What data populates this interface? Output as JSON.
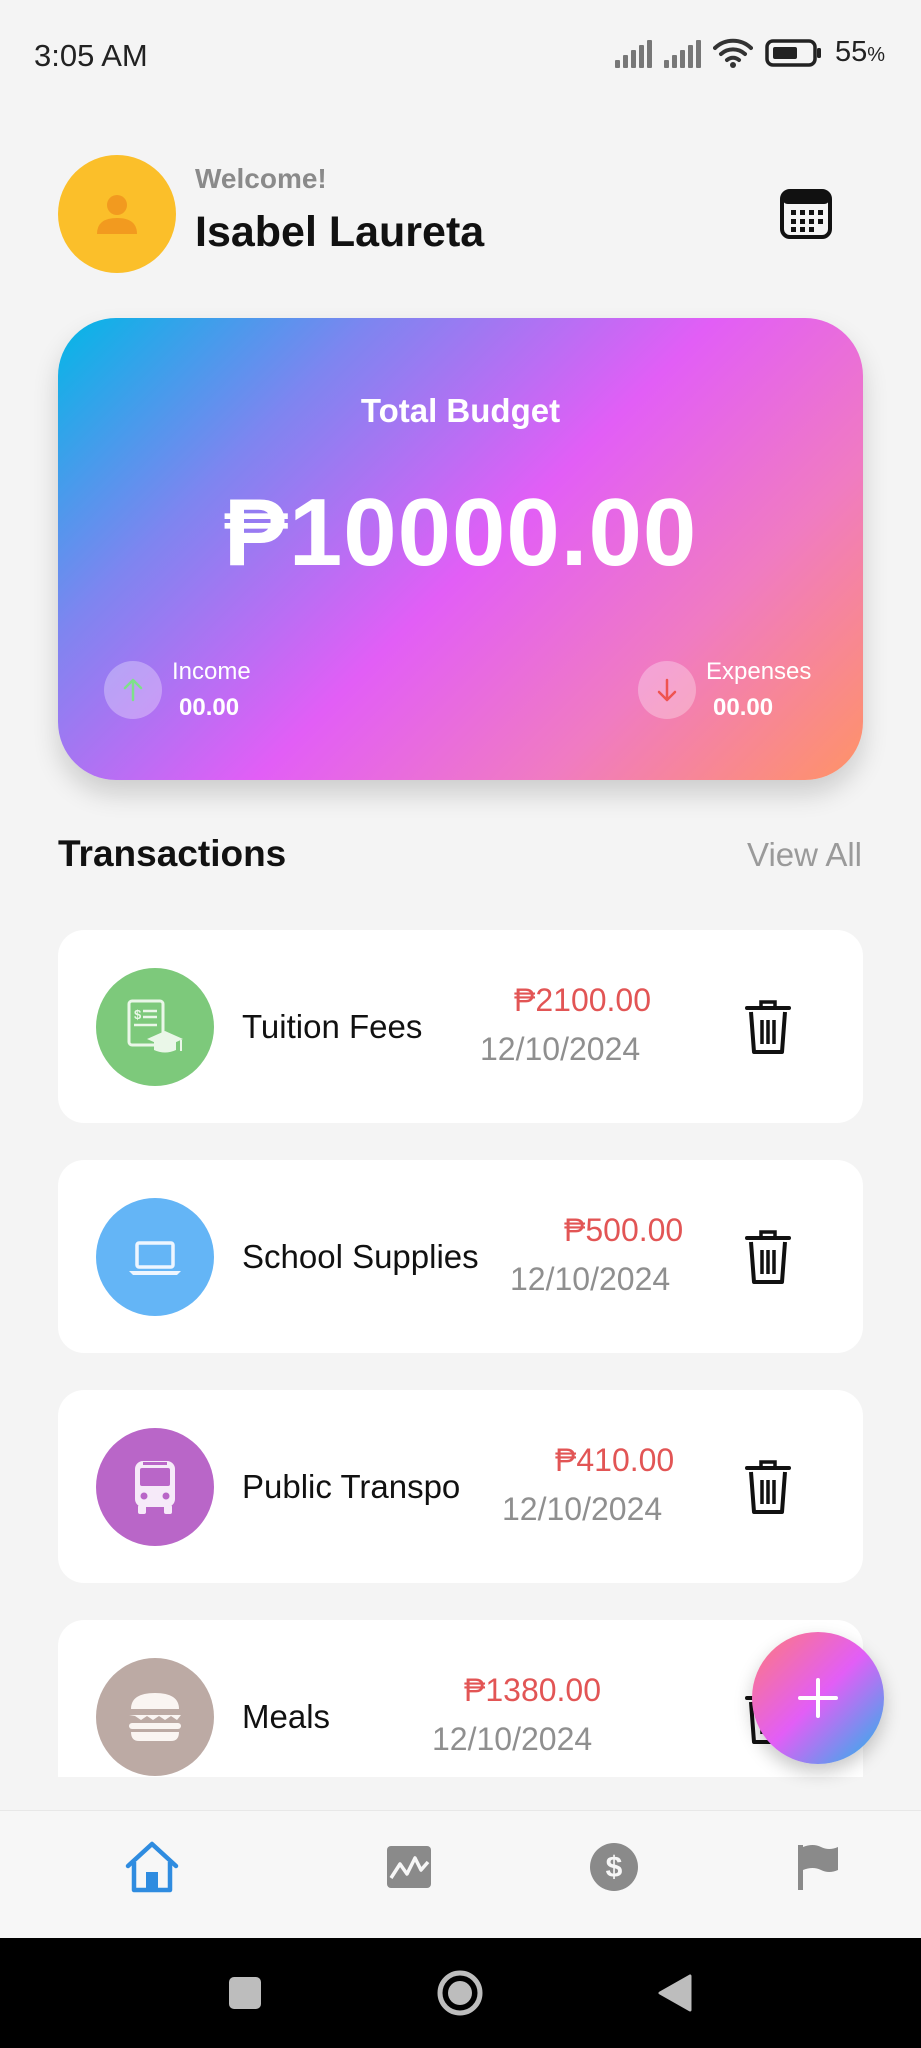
{
  "status_bar": {
    "time": "3:05 AM",
    "battery": "55",
    "battery_unit": "%"
  },
  "header": {
    "welcome": "Welcome!",
    "user_name": "Isabel Laureta"
  },
  "budget": {
    "label": "Total Budget",
    "amount": "₱10000.00",
    "income_label": "Income",
    "income_value": "00.00",
    "expenses_label": "Expenses",
    "expenses_value": "00.00"
  },
  "transactions_section": {
    "title": "Transactions",
    "view_all": "View All"
  },
  "transactions": [
    {
      "name": "Tuition Fees",
      "amount": "₱2100.00",
      "date": "12/10/2024",
      "icon": "tuition-icon",
      "color": "#7dc97b"
    },
    {
      "name": "School Supplies",
      "amount": "₱500.00",
      "date": "12/10/2024",
      "icon": "laptop-icon",
      "color": "#64b5f6"
    },
    {
      "name": "Public Transpo",
      "amount": "₱410.00",
      "date": "12/10/2024",
      "icon": "bus-icon",
      "color": "#b966c8"
    },
    {
      "name": "Meals",
      "amount": "₱1380.00",
      "date": "12/10/2024",
      "icon": "burger-icon",
      "color": "#bcaaa4"
    }
  ],
  "colors": {
    "active_nav": "#2f8ce0",
    "inactive_nav": "#8a8a8a",
    "amount_red": "#e25555",
    "avatar_yellow": "#fbbf2a"
  }
}
